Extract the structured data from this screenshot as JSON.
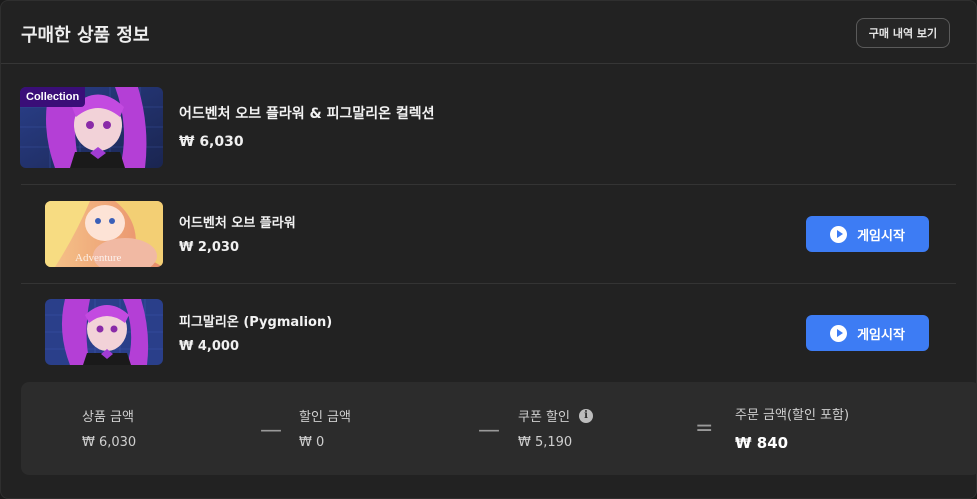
{
  "header": {
    "title": "구매한 상품 정보",
    "history_button": "구매 내역 보기"
  },
  "collection": {
    "badge": "Collection",
    "name": "어드벤처 오브 플라워 & 피그말리온 컬렉션",
    "price": "₩ 6,030"
  },
  "items": [
    {
      "name": "어드벤처 오브 플라워",
      "price": "₩ 2,030",
      "button": "게임시작"
    },
    {
      "name": "피그말리온 (Pygmalion)",
      "price": "₩ 4,000",
      "button": "게임시작"
    }
  ],
  "summary": {
    "product_amount_label": "상품 금액",
    "product_amount_value": "₩ 6,030",
    "op1": "—",
    "discount_label": "할인 금액",
    "discount_value": "₩ 0",
    "op2": "—",
    "coupon_label": "쿠폰 할인",
    "coupon_value": "₩ 5,190",
    "op3": "=",
    "order_total_label": "주문 금액(할인 포함)",
    "order_total_value": "₩ 840"
  },
  "colors": {
    "accent": "#3d7cf4",
    "badge": "#3a0e78",
    "background": "#222222"
  },
  "icons": {
    "play": "play-circle-icon",
    "info": "info-icon"
  }
}
